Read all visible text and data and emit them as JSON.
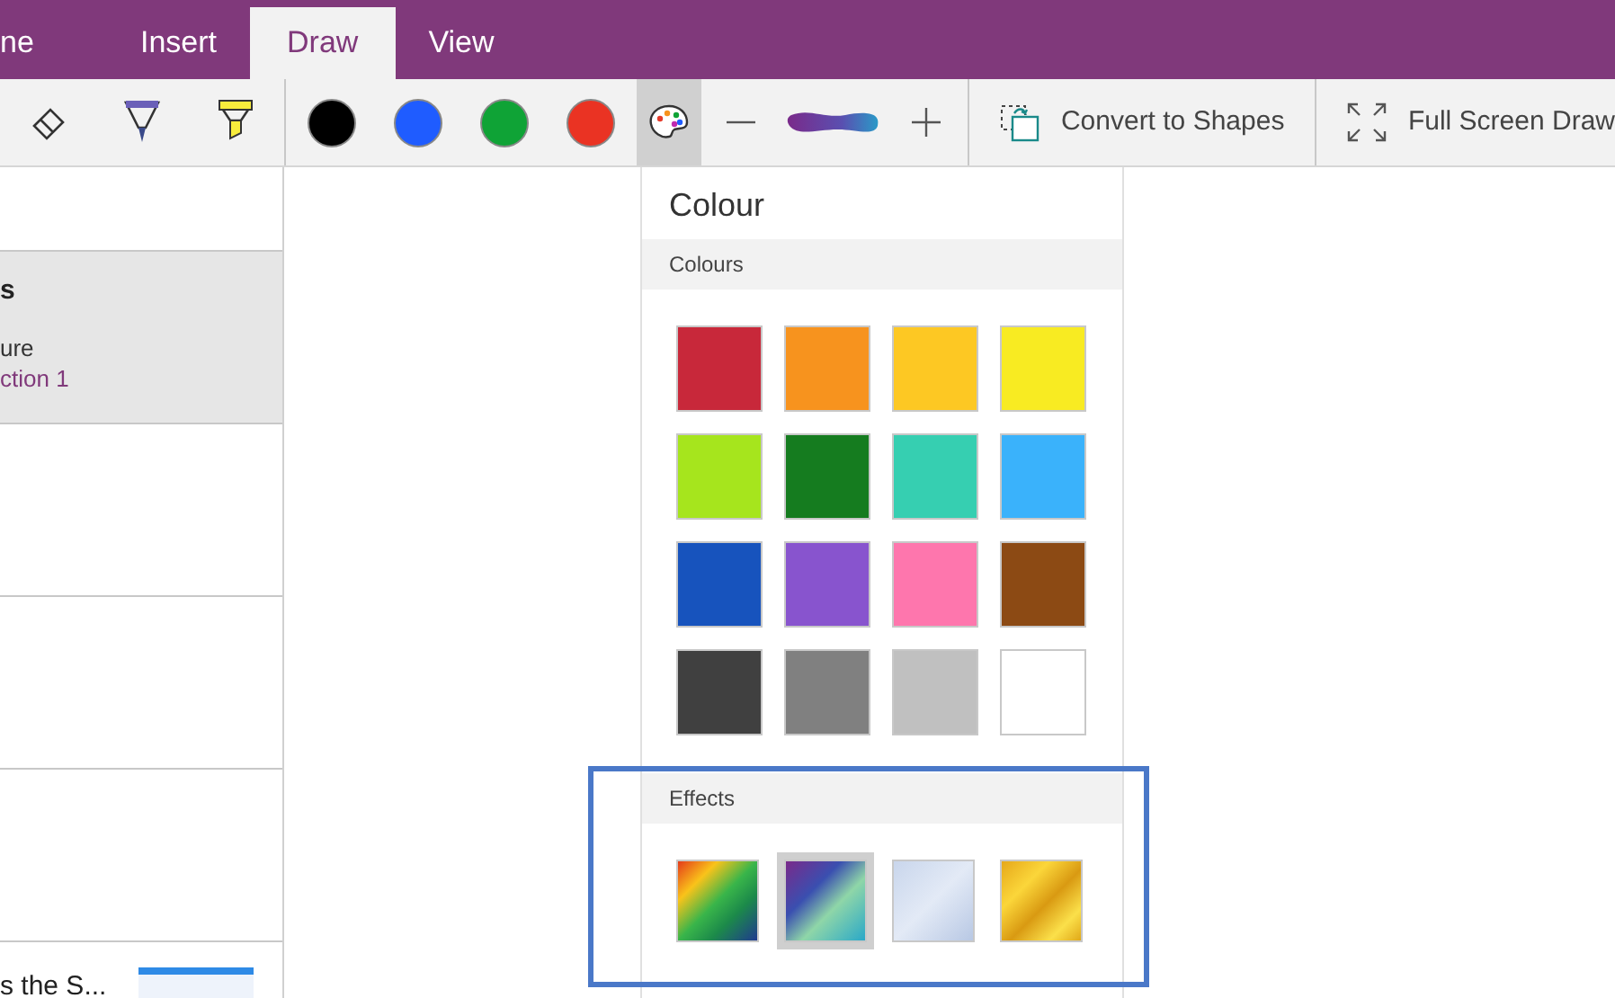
{
  "tabs": [
    {
      "label": "ne",
      "selected": false
    },
    {
      "label": "Insert",
      "selected": false
    },
    {
      "label": "Draw",
      "selected": true
    },
    {
      "label": "View",
      "selected": false
    }
  ],
  "toolbar": {
    "tools": [
      {
        "kind": "eraser"
      },
      {
        "kind": "pen"
      },
      {
        "kind": "highlighter"
      }
    ],
    "pen_colors": [
      {
        "color": "#000000",
        "selected": false
      },
      {
        "color": "#1f5cff",
        "selected": false
      },
      {
        "color": "#0fa336",
        "selected": false
      },
      {
        "color": "#ea3323",
        "selected": false
      }
    ],
    "palette_button": {
      "selected": true
    },
    "convert_button": "Convert to Shapes",
    "full_screen_button": "Full Screen Draw"
  },
  "pages": [
    {
      "selected": false
    },
    {
      "title": "s",
      "subtitle": "ure",
      "section": "ction 1",
      "selected": true
    },
    {
      "selected": false
    },
    {
      "selected": false
    },
    {
      "selected": false
    },
    {
      "title": "s the S...",
      "thumbnail": true,
      "selected": false
    }
  ],
  "colour_panel": {
    "title": "Colour",
    "colours_header": "Colours",
    "colours": [
      {
        "color": "#c8283a"
      },
      {
        "color": "#f7931e"
      },
      {
        "color": "#fdc823"
      },
      {
        "color": "#f8eb22"
      },
      {
        "color": "#a6e51d"
      },
      {
        "color": "#157c1f"
      },
      {
        "color": "#36cfb1"
      },
      {
        "color": "#3ab2fb"
      },
      {
        "color": "#1753bd"
      },
      {
        "color": "#8854ce"
      },
      {
        "color": "#fe76ad"
      },
      {
        "color": "#8c4a14"
      },
      {
        "color": "#404040"
      },
      {
        "color": "#808080"
      },
      {
        "color": "#c0c0c0"
      },
      {
        "color": "#ffffff"
      }
    ],
    "effects_header": "Effects",
    "effects": [
      {
        "selected": false
      },
      {
        "selected": true
      },
      {
        "selected": false
      },
      {
        "selected": false
      }
    ]
  }
}
